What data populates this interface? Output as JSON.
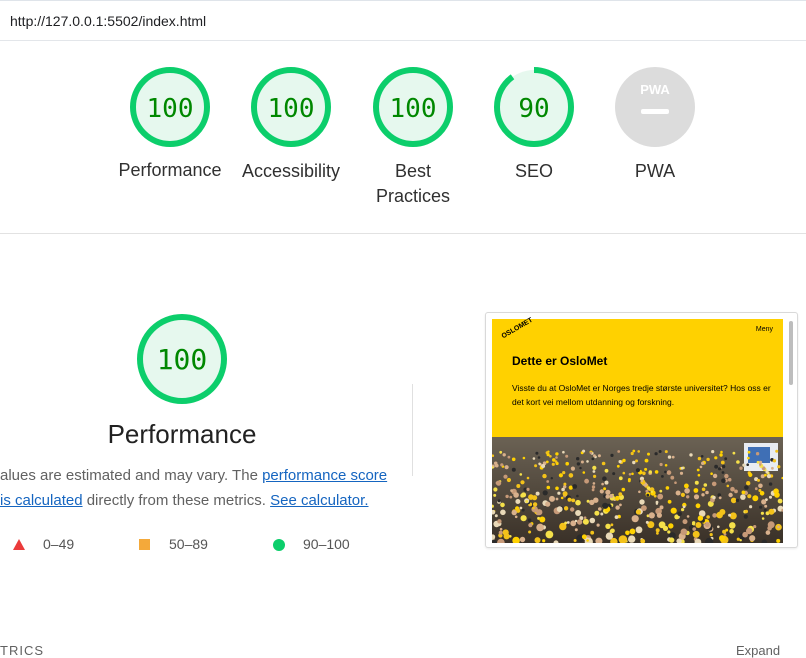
{
  "address_bar": {
    "url": "http://127.0.0.1:5502/index.html"
  },
  "gauges": [
    {
      "label": "Performance",
      "score": "100",
      "fraction": 1.0
    },
    {
      "label": "Accessibility",
      "score": "100",
      "fraction": 1.0
    },
    {
      "label": "Best Practices",
      "label_line1": "Best",
      "label_line2": "Practices",
      "score": "100",
      "fraction": 1.0
    },
    {
      "label": "SEO",
      "score": "90",
      "fraction": 0.9
    },
    {
      "label": "PWA",
      "badge_text": "PWA",
      "score": ""
    }
  ],
  "performance": {
    "score": "100",
    "title": "Performance",
    "desc_part1": "alues are estimated and may vary. The ",
    "desc_link1_line1": "performance score",
    "desc_link1_line2": "is calculated",
    "desc_part2": " directly from these metrics. ",
    "desc_link2": "See calculator."
  },
  "legend": [
    {
      "range": "0–49",
      "icon": "fail-triangle-icon"
    },
    {
      "range": "50–89",
      "icon": "average-square-icon"
    },
    {
      "range": "90–100",
      "icon": "pass-circle-icon"
    }
  ],
  "screenshot": {
    "logo": "OSLOMET",
    "menu": "Meny",
    "heading": "Dette er OsloMet",
    "body": "Visste du at OsloMet er Norges tredje største universitet? Hos oss er det kort vei mellom utdanning og forskning."
  },
  "bottom": {
    "metrics_label": "TRICS",
    "expand_label": "Expand"
  },
  "colors": {
    "pass": "#0cce6b",
    "pass_bg": "#e6f8ee",
    "pass_text": "#008800",
    "average": "#f4a93a",
    "fail": "#eb3b3b",
    "link": "#1565c0",
    "oslomet_yellow": "#ffd100"
  }
}
